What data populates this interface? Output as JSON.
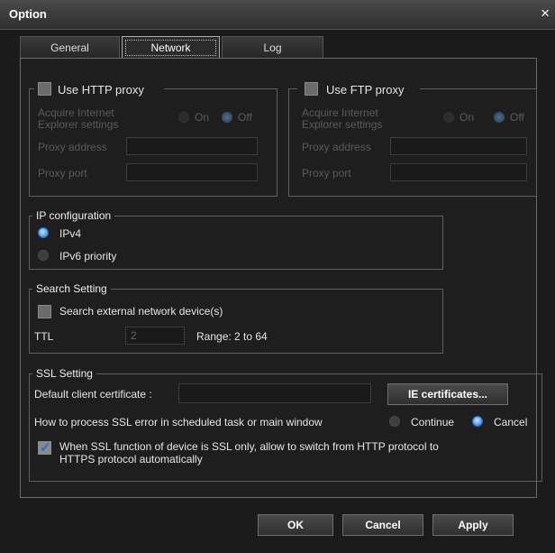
{
  "window": {
    "title": "Option",
    "close_glyph": "×"
  },
  "tabs": [
    {
      "label": "General",
      "active": false
    },
    {
      "label": "Network",
      "active": true
    },
    {
      "label": "Log",
      "active": false
    }
  ],
  "http_proxy": {
    "label": "Use HTTP proxy",
    "checked": false,
    "acquire_label_1": "Acquire Internet",
    "acquire_label_2": "Explorer settings",
    "on_label": "On",
    "off_label": "Off",
    "address_label": "Proxy address",
    "port_label": "Proxy port",
    "address_value": "",
    "port_value": ""
  },
  "ftp_proxy": {
    "label": "Use FTP proxy",
    "checked": false,
    "acquire_label_1": "Acquire Internet",
    "acquire_label_2": "Explorer settings",
    "on_label": "On",
    "off_label": "Off",
    "address_label": "Proxy address",
    "port_label": "Proxy port",
    "address_value": "",
    "port_value": ""
  },
  "ip_config": {
    "title": "IP configuration",
    "options": [
      "IPv4",
      "IPv6 priority"
    ],
    "selected": "IPv4"
  },
  "search": {
    "title": "Search Setting",
    "external_label": "Search external network device(s)",
    "external_checked": false,
    "ttl_label": "TTL",
    "ttl_value": "2",
    "range_label": "Range: 2 to 64"
  },
  "ssl": {
    "title": "SSL Setting",
    "cert_label": "Default client certificate :",
    "cert_value": "",
    "ie_cert_button": "IE certificates...",
    "error_label": "How to process SSL error in scheduled task or main window",
    "continue_label": "Continue",
    "cancel_label": "Cancel",
    "error_selected": "Cancel",
    "switch_line1": "When SSL function of device is SSL only, allow to switch from HTTP protocol  to",
    "switch_line2": "HTTPS protocol automatically",
    "switch_checked": true
  },
  "footer": {
    "ok": "OK",
    "cancel": "Cancel",
    "apply": "Apply"
  }
}
